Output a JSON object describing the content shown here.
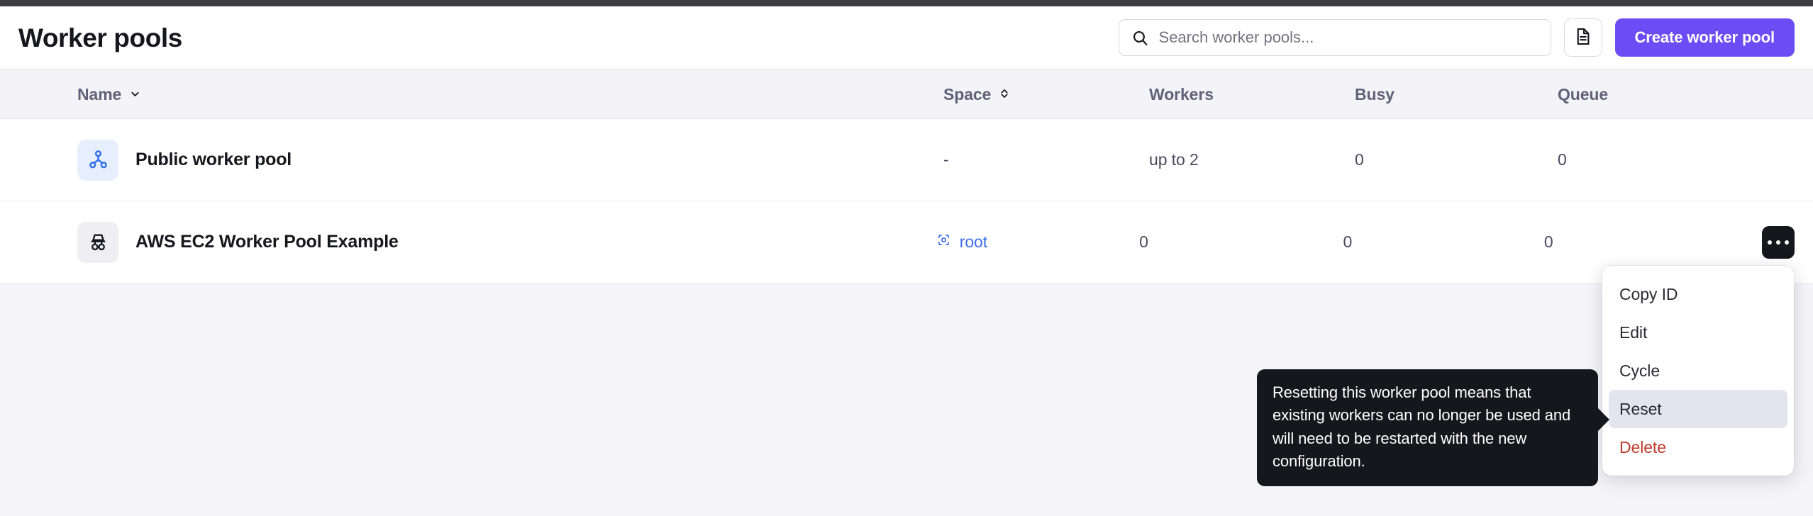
{
  "header": {
    "title": "Worker pools",
    "search": {
      "placeholder": "Search worker pools...",
      "value": "",
      "icon": "search-icon"
    },
    "docs_button": {
      "icon": "document-icon"
    },
    "create_button": {
      "label": "Create worker pool",
      "color": "#6b4df6"
    }
  },
  "table": {
    "columns": [
      {
        "key": "name",
        "label": "Name",
        "sort": "desc"
      },
      {
        "key": "space",
        "label": "Space",
        "sort": "none"
      },
      {
        "key": "workers",
        "label": "Workers",
        "sort": null
      },
      {
        "key": "busy",
        "label": "Busy",
        "sort": null
      },
      {
        "key": "queue",
        "label": "Queue",
        "sort": null
      }
    ],
    "rows": [
      {
        "icon": "public-worker-pool-icon",
        "icon_style": "blue",
        "name": "Public worker pool",
        "space": "-",
        "space_is_link": false,
        "workers": "up to 2",
        "busy": "0",
        "queue": "0"
      },
      {
        "icon": "worker-pool-icon",
        "icon_style": "gray",
        "name": "AWS EC2 Worker Pool Example",
        "space": "root",
        "space_is_link": true,
        "space_icon": "space-icon",
        "workers": "0",
        "busy": "0",
        "queue": "0"
      }
    ]
  },
  "context_menu": {
    "items": [
      {
        "label": "Copy ID",
        "state": "normal"
      },
      {
        "label": "Edit",
        "state": "normal"
      },
      {
        "label": "Cycle",
        "state": "normal"
      },
      {
        "label": "Reset",
        "state": "highlighted"
      },
      {
        "label": "Delete",
        "state": "danger"
      }
    ]
  },
  "tooltip": {
    "text": "Resetting this worker pool means that existing workers can no longer be used and will need to be restarted with the new configuration.",
    "background": "#16161d"
  }
}
